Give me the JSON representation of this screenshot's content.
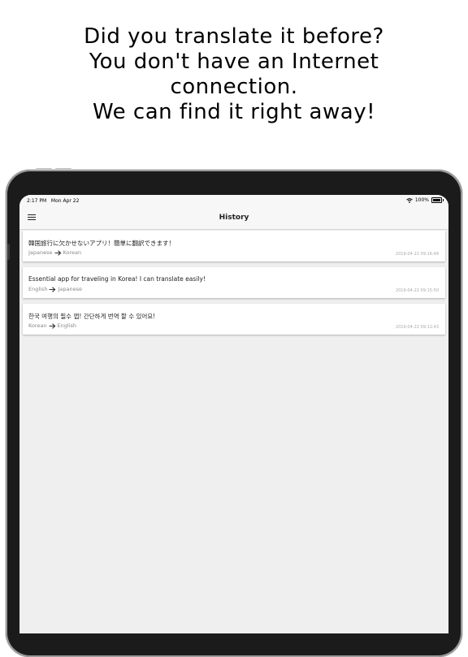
{
  "promo": {
    "lines": [
      "Did you translate it before?",
      "You don't have an Internet",
      "connection.",
      "We can find it right away!"
    ]
  },
  "statusbar": {
    "time": "2:17 PM",
    "date": "Mon Apr 22",
    "battery": "100%",
    "icons": [
      "wifi-icon",
      "battery-icon"
    ]
  },
  "navbar": {
    "title": "History",
    "menu_icon": "hamburger-menu-icon"
  },
  "history": [
    {
      "text": "韓国旅行に欠かせないアプリ！簡単に翻訳できます！",
      "source": "Japanese",
      "target": "Korean",
      "date": "2019-04-22 09:16:48"
    },
    {
      "text": "Essential app for traveling in Korea! I can translate easily!",
      "source": "English",
      "target": "Japanese",
      "date": "2019-04-22 09:15:50"
    },
    {
      "text": "한국 여행의 필수 앱! 간단하게 번역 할 수 있어요!",
      "source": "Korean",
      "target": "English",
      "date": "2019-04-22 09:12:43"
    }
  ],
  "colors": {
    "background": "#ffffff",
    "device_frame": "#1b1b1b",
    "screen_bg": "#efefef",
    "navbar_bg": "#f7f7f7",
    "card_bg": "#ffffff"
  }
}
